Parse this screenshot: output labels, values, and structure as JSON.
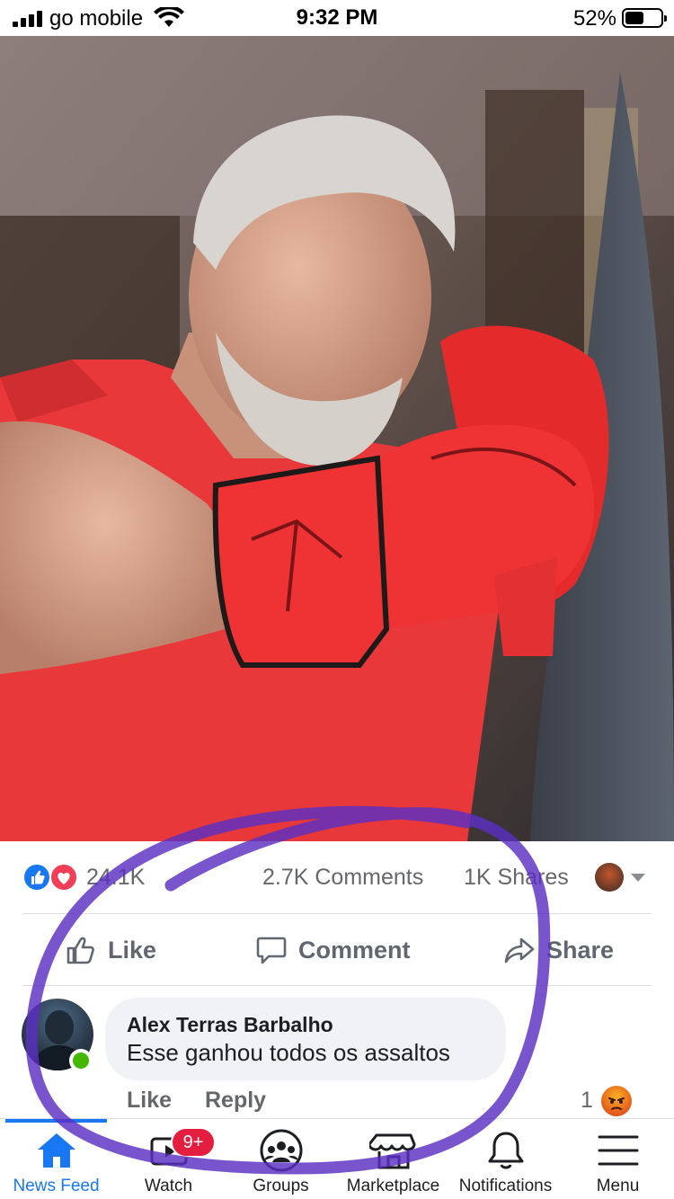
{
  "status_bar": {
    "carrier": "go mobile",
    "time": "9:32 PM",
    "battery": "52%",
    "battery_level": 0.52
  },
  "post": {
    "photo_icon": "boxing-photo",
    "reactions_count": "24.1K",
    "comments_count": "2.7K Comments",
    "shares_count": "1K Shares",
    "actions": {
      "like": "Like",
      "comment": "Comment",
      "share": "Share"
    }
  },
  "comment": {
    "author": "Alex Terras Barbalho",
    "text": "Esse ganhou todos os assaltos",
    "like": "Like",
    "reply": "Reply",
    "reaction_count": "1",
    "reaction_icon": "angry-icon"
  },
  "tabbar": {
    "tabs": [
      {
        "label": "News Feed",
        "icon": "home-icon",
        "active": true
      },
      {
        "label": "Watch",
        "icon": "watch-icon",
        "active": false
      },
      {
        "label": "Groups",
        "icon": "groups-icon",
        "active": false
      },
      {
        "label": "Marketplace",
        "icon": "marketplace-icon",
        "active": false
      },
      {
        "label": "Notifications",
        "icon": "bell-icon",
        "active": false
      },
      {
        "label": "Menu",
        "icon": "menu-icon",
        "active": false
      }
    ],
    "watch_badge": "9+"
  },
  "colors": {
    "accent": "#1877f2",
    "badge": "#e41e3f",
    "annotation": "#5a2fc2"
  }
}
